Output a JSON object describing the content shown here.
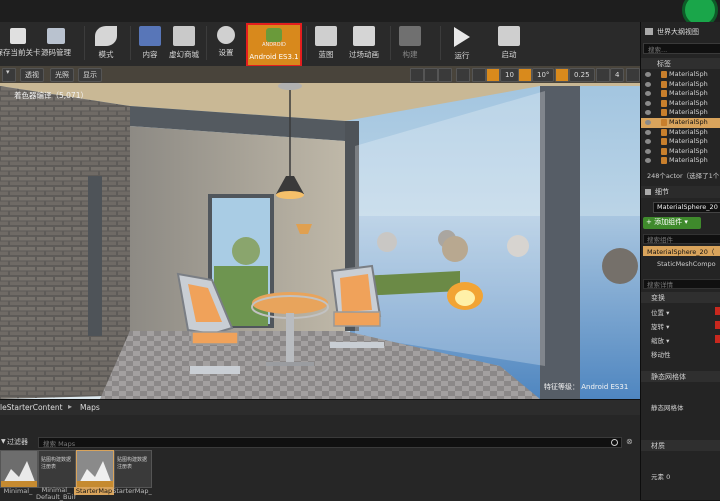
{
  "toolbar": {
    "buttons": [
      {
        "id": "save",
        "label": "保存当前关卡"
      },
      {
        "id": "source",
        "label": "源码管理"
      },
      {
        "id": "modes",
        "label": "模式"
      },
      {
        "id": "content",
        "label": "内容"
      },
      {
        "id": "market",
        "label": "虚幻商城"
      },
      {
        "id": "settings",
        "label": "设置"
      },
      {
        "id": "android",
        "label": "Android ES3.1",
        "icon_text": "ANDROID"
      },
      {
        "id": "blueprint",
        "label": "蓝图"
      },
      {
        "id": "cinematics",
        "label": "过场动画"
      },
      {
        "id": "build",
        "label": "构建"
      },
      {
        "id": "play",
        "label": "运行"
      },
      {
        "id": "launch",
        "label": "启动"
      }
    ]
  },
  "viewport": {
    "buttons": [
      "透视",
      "光照",
      "显示"
    ],
    "shader_info": "着色器编译（5,071）",
    "rotation_snap": "10°",
    "scale_snap": "0.25",
    "camera_speed": "4",
    "feature_level": "特征等级：  Android ES31"
  },
  "outliner": {
    "title": "世界大纲视图",
    "search_placeholder": "搜索...",
    "column": "标签",
    "items": [
      "MaterialSph",
      "MaterialSph",
      "MaterialSph",
      "MaterialSph",
      "MaterialSph",
      "MaterialSph",
      "MaterialSph",
      "MaterialSph",
      "MaterialSph",
      "MaterialSph"
    ],
    "selected_index": 5,
    "footer": "248个actor（选择了1个"
  },
  "details": {
    "title": "细节",
    "name_value": "MaterialSphere_20",
    "add_component": "+ 添加组件 ▾",
    "search_components": "搜索组件",
    "components": [
      "MaterialSphere_20（",
      "StaticMeshCompo"
    ],
    "search_details": "搜索详情",
    "transform": "变换",
    "location": "位置 ▾",
    "rotation": "旋转 ▾",
    "scale": "缩放 ▾",
    "mobility": "移动性",
    "static_mesh_section": "静态网格体",
    "static_mesh_label": "静态网格体",
    "materials_section": "材质",
    "element0": "元素 0"
  },
  "content_browser": {
    "path_root": "leStarterContent",
    "path_leaf": "Maps",
    "filters": "过滤器",
    "search_placeholder": "搜索 Maps",
    "assets": [
      {
        "label": "Minimal_",
        "kind": "map"
      },
      {
        "label": "Minimal_ Default_Built",
        "kind": "data",
        "tag": "贴图构建数据注册表"
      },
      {
        "label": "StarterMap",
        "kind": "map"
      },
      {
        "label": "StarterMap_",
        "kind": "data",
        "tag": "贴图构建数据注册表"
      }
    ]
  }
}
